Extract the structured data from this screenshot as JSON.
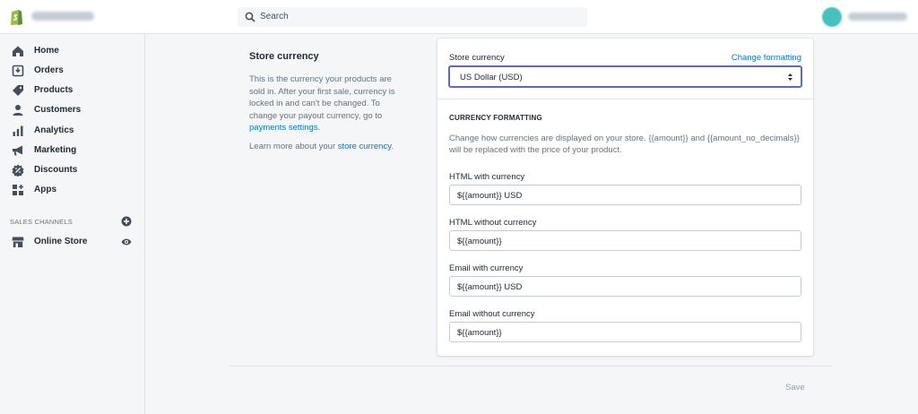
{
  "topbar": {
    "search_placeholder": "Search"
  },
  "sidebar": {
    "items": [
      {
        "label": "Home",
        "icon": "home-icon"
      },
      {
        "label": "Orders",
        "icon": "orders-icon"
      },
      {
        "label": "Products",
        "icon": "tag-icon"
      },
      {
        "label": "Customers",
        "icon": "person-icon"
      },
      {
        "label": "Analytics",
        "icon": "bar-chart-icon"
      },
      {
        "label": "Marketing",
        "icon": "megaphone-icon"
      },
      {
        "label": "Discounts",
        "icon": "discount-icon"
      },
      {
        "label": "Apps",
        "icon": "apps-icon"
      }
    ],
    "channels_label": "SALES CHANNELS",
    "online_store_label": "Online Store"
  },
  "description": {
    "title": "Store currency",
    "text": "This is the currency your products are sold in. After your first sale, currency is locked in and can't be changed. To change your payout currency, go to ",
    "payments_link": "payments settings",
    "text_end": ".",
    "more_prefix": "Learn more about your ",
    "more_link": "store currency",
    "more_suffix": "."
  },
  "card": {
    "store_currency_label": "Store currency",
    "change_formatting_link": "Change formatting",
    "currency_value": "US Dollar (USD)",
    "formatting_heading": "CURRENCY FORMATTING",
    "formatting_desc": "Change how currencies are displayed on your store. {{amount}} and {{amount_no_decimals}} will be replaced with the price of your product.",
    "fields": [
      {
        "label": "HTML with currency",
        "value": "${{amount}} USD"
      },
      {
        "label": "HTML without currency",
        "value": "${{amount}}"
      },
      {
        "label": "Email with currency",
        "value": "${{amount}} USD"
      },
      {
        "label": "Email without currency",
        "value": "${{amount}}"
      }
    ]
  },
  "footer": {
    "save_label": "Save"
  },
  "colors": {
    "accent": "#5c6ac4",
    "link": "#007ace",
    "logo": "#95bf47",
    "avatar": "#47c1bf"
  }
}
